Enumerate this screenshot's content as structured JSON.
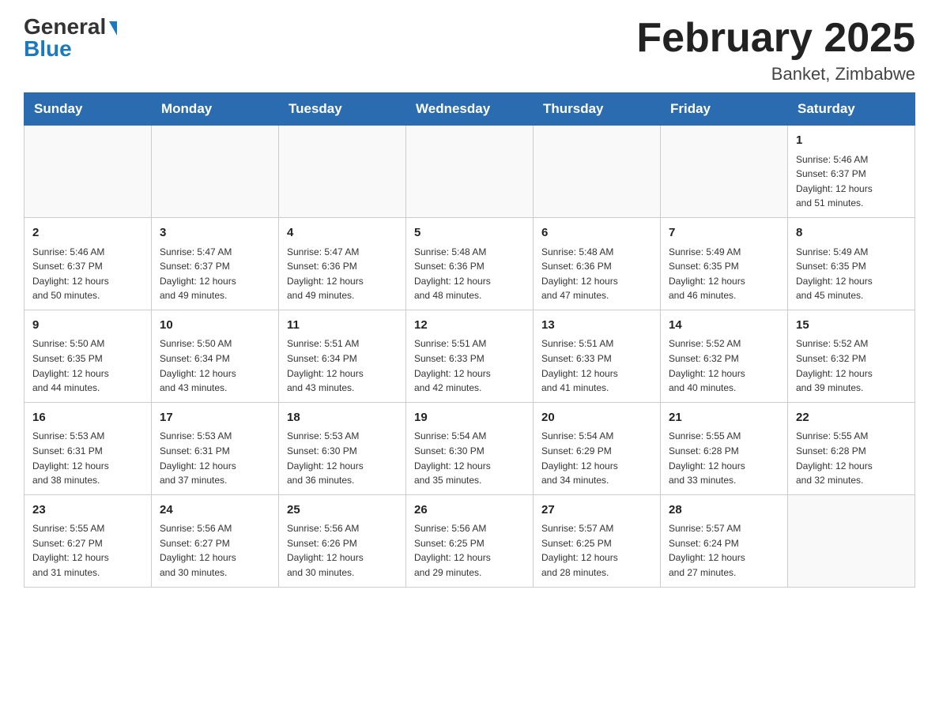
{
  "header": {
    "logo_general": "General",
    "logo_blue": "Blue",
    "title": "February 2025",
    "subtitle": "Banket, Zimbabwe"
  },
  "days_of_week": [
    "Sunday",
    "Monday",
    "Tuesday",
    "Wednesday",
    "Thursday",
    "Friday",
    "Saturday"
  ],
  "weeks": [
    {
      "days": [
        {
          "number": "",
          "info": ""
        },
        {
          "number": "",
          "info": ""
        },
        {
          "number": "",
          "info": ""
        },
        {
          "number": "",
          "info": ""
        },
        {
          "number": "",
          "info": ""
        },
        {
          "number": "",
          "info": ""
        },
        {
          "number": "1",
          "info": "Sunrise: 5:46 AM\nSunset: 6:37 PM\nDaylight: 12 hours\nand 51 minutes."
        }
      ]
    },
    {
      "days": [
        {
          "number": "2",
          "info": "Sunrise: 5:46 AM\nSunset: 6:37 PM\nDaylight: 12 hours\nand 50 minutes."
        },
        {
          "number": "3",
          "info": "Sunrise: 5:47 AM\nSunset: 6:37 PM\nDaylight: 12 hours\nand 49 minutes."
        },
        {
          "number": "4",
          "info": "Sunrise: 5:47 AM\nSunset: 6:36 PM\nDaylight: 12 hours\nand 49 minutes."
        },
        {
          "number": "5",
          "info": "Sunrise: 5:48 AM\nSunset: 6:36 PM\nDaylight: 12 hours\nand 48 minutes."
        },
        {
          "number": "6",
          "info": "Sunrise: 5:48 AM\nSunset: 6:36 PM\nDaylight: 12 hours\nand 47 minutes."
        },
        {
          "number": "7",
          "info": "Sunrise: 5:49 AM\nSunset: 6:35 PM\nDaylight: 12 hours\nand 46 minutes."
        },
        {
          "number": "8",
          "info": "Sunrise: 5:49 AM\nSunset: 6:35 PM\nDaylight: 12 hours\nand 45 minutes."
        }
      ]
    },
    {
      "days": [
        {
          "number": "9",
          "info": "Sunrise: 5:50 AM\nSunset: 6:35 PM\nDaylight: 12 hours\nand 44 minutes."
        },
        {
          "number": "10",
          "info": "Sunrise: 5:50 AM\nSunset: 6:34 PM\nDaylight: 12 hours\nand 43 minutes."
        },
        {
          "number": "11",
          "info": "Sunrise: 5:51 AM\nSunset: 6:34 PM\nDaylight: 12 hours\nand 43 minutes."
        },
        {
          "number": "12",
          "info": "Sunrise: 5:51 AM\nSunset: 6:33 PM\nDaylight: 12 hours\nand 42 minutes."
        },
        {
          "number": "13",
          "info": "Sunrise: 5:51 AM\nSunset: 6:33 PM\nDaylight: 12 hours\nand 41 minutes."
        },
        {
          "number": "14",
          "info": "Sunrise: 5:52 AM\nSunset: 6:32 PM\nDaylight: 12 hours\nand 40 minutes."
        },
        {
          "number": "15",
          "info": "Sunrise: 5:52 AM\nSunset: 6:32 PM\nDaylight: 12 hours\nand 39 minutes."
        }
      ]
    },
    {
      "days": [
        {
          "number": "16",
          "info": "Sunrise: 5:53 AM\nSunset: 6:31 PM\nDaylight: 12 hours\nand 38 minutes."
        },
        {
          "number": "17",
          "info": "Sunrise: 5:53 AM\nSunset: 6:31 PM\nDaylight: 12 hours\nand 37 minutes."
        },
        {
          "number": "18",
          "info": "Sunrise: 5:53 AM\nSunset: 6:30 PM\nDaylight: 12 hours\nand 36 minutes."
        },
        {
          "number": "19",
          "info": "Sunrise: 5:54 AM\nSunset: 6:30 PM\nDaylight: 12 hours\nand 35 minutes."
        },
        {
          "number": "20",
          "info": "Sunrise: 5:54 AM\nSunset: 6:29 PM\nDaylight: 12 hours\nand 34 minutes."
        },
        {
          "number": "21",
          "info": "Sunrise: 5:55 AM\nSunset: 6:28 PM\nDaylight: 12 hours\nand 33 minutes."
        },
        {
          "number": "22",
          "info": "Sunrise: 5:55 AM\nSunset: 6:28 PM\nDaylight: 12 hours\nand 32 minutes."
        }
      ]
    },
    {
      "days": [
        {
          "number": "23",
          "info": "Sunrise: 5:55 AM\nSunset: 6:27 PM\nDaylight: 12 hours\nand 31 minutes."
        },
        {
          "number": "24",
          "info": "Sunrise: 5:56 AM\nSunset: 6:27 PM\nDaylight: 12 hours\nand 30 minutes."
        },
        {
          "number": "25",
          "info": "Sunrise: 5:56 AM\nSunset: 6:26 PM\nDaylight: 12 hours\nand 30 minutes."
        },
        {
          "number": "26",
          "info": "Sunrise: 5:56 AM\nSunset: 6:25 PM\nDaylight: 12 hours\nand 29 minutes."
        },
        {
          "number": "27",
          "info": "Sunrise: 5:57 AM\nSunset: 6:25 PM\nDaylight: 12 hours\nand 28 minutes."
        },
        {
          "number": "28",
          "info": "Sunrise: 5:57 AM\nSunset: 6:24 PM\nDaylight: 12 hours\nand 27 minutes."
        },
        {
          "number": "",
          "info": ""
        }
      ]
    }
  ]
}
